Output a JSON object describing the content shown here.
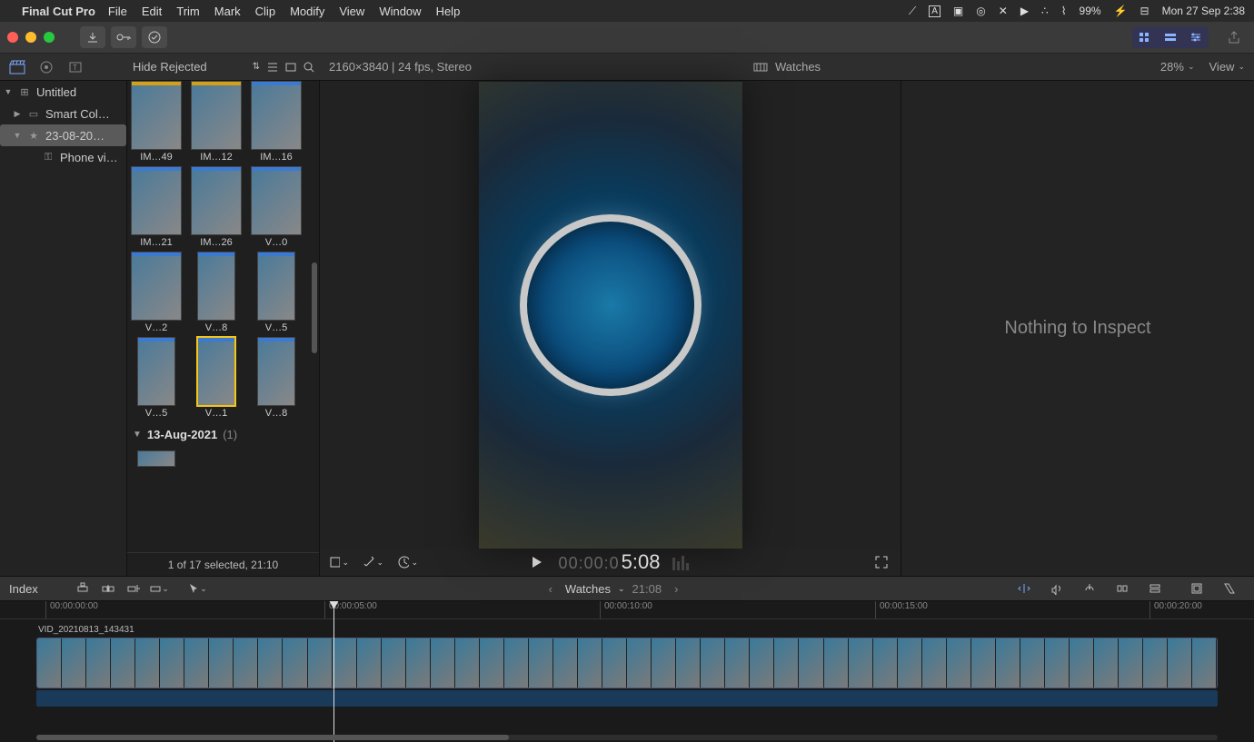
{
  "menubar": {
    "app": "Final Cut Pro",
    "items": [
      "File",
      "Edit",
      "Trim",
      "Mark",
      "Clip",
      "Modify",
      "View",
      "Window",
      "Help"
    ],
    "battery": "99%",
    "datetime": "Mon 27 Sep  2:38"
  },
  "subbar": {
    "hide_rejected": "Hide Rejected",
    "spec": "2160×3840 | 24 fps, Stereo",
    "project": "Watches",
    "zoom": "28%",
    "view": "View"
  },
  "sidebar": {
    "items": [
      {
        "label": "Untitled",
        "expanded": true,
        "indent": 0,
        "icon": "grid"
      },
      {
        "label": "Smart Col…",
        "expanded": false,
        "indent": 1,
        "icon": "folder"
      },
      {
        "label": "23-08-20…",
        "expanded": true,
        "indent": 1,
        "icon": "star",
        "selected": true
      },
      {
        "label": "Phone vi…",
        "expanded": false,
        "indent": 2,
        "icon": "key"
      }
    ]
  },
  "browser": {
    "clips_row1": [
      {
        "label": "IM…49"
      },
      {
        "label": "IM…12"
      }
    ],
    "clips_row2": [
      {
        "label": "IM…16"
      },
      {
        "label": "IM…21"
      }
    ],
    "clips_row3": [
      {
        "label": "IM…26"
      },
      {
        "label": "V…0"
      },
      {
        "label": "V…2"
      }
    ],
    "clips_row4": [
      {
        "label": "V…8"
      },
      {
        "label": "V…5"
      },
      {
        "label": "V…5"
      }
    ],
    "clips_row5": [
      {
        "label": "V…1",
        "sel": true
      },
      {
        "label": "V…8"
      }
    ],
    "date_header": "13-Aug-2021",
    "date_count": "(1)",
    "status": "1 of 17 selected, 21:10"
  },
  "viewer": {
    "timecode_dim": "00:00:0",
    "timecode_bright": "5:08"
  },
  "inspector": {
    "message": "Nothing to Inspect"
  },
  "tlheader": {
    "index": "Index",
    "project": "Watches",
    "duration": "21:08"
  },
  "timeline": {
    "ticks": [
      {
        "pos": 50,
        "label": "00:00:00:00"
      },
      {
        "pos": 357,
        "label": "00:00:05:00"
      },
      {
        "pos": 660,
        "label": "00:00:10:00"
      },
      {
        "pos": 963,
        "label": "00:00:15:00"
      },
      {
        "pos": 1265,
        "label": "00:00:20:00"
      }
    ],
    "clip_name": "VID_20210813_143431"
  }
}
